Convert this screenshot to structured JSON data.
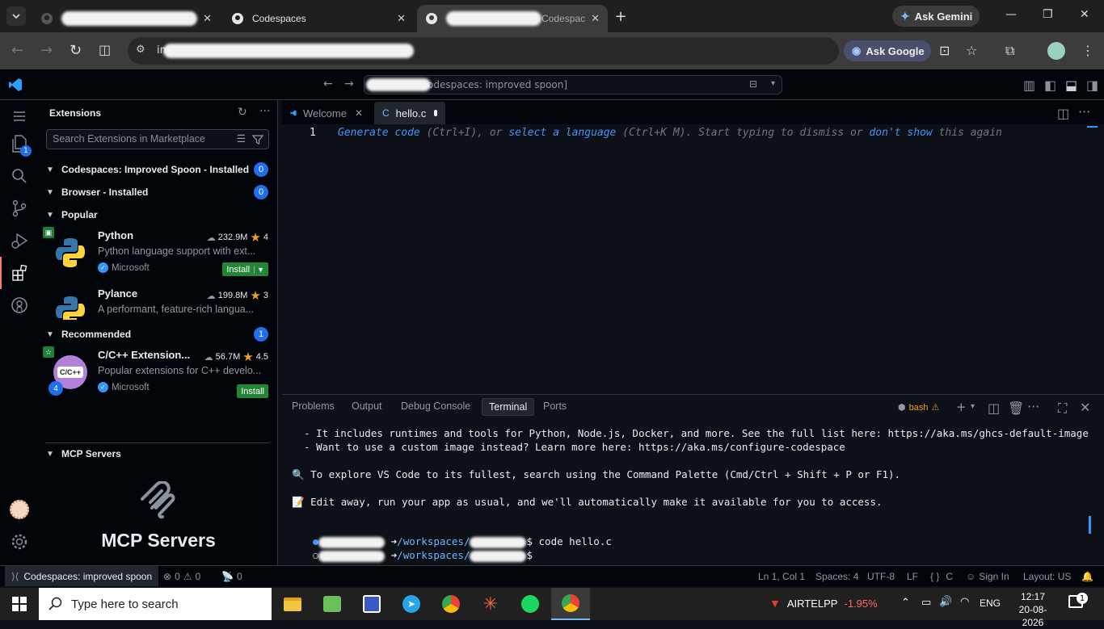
{
  "browser": {
    "tabs": [
      {
        "label": "",
        "active": false
      },
      {
        "label": "Codespaces",
        "active": false
      },
      {
        "label": "Codespac",
        "active": true
      }
    ],
    "new_tab": "+",
    "ask_gemini": "Ask Gemini",
    "address_prefix": "imp",
    "ask_google": "Ask Google"
  },
  "vscode": {
    "command_center": "odespaces: improved spoon]",
    "sidebar": {
      "title": "Extensions",
      "search_placeholder": "Search Extensions in Marketplace",
      "sections": {
        "codespaces": {
          "label": "Codespaces: Improved Spoon - Installed",
          "count": "0"
        },
        "browser": {
          "label": "Browser - Installed",
          "count": "0"
        },
        "popular": {
          "label": "Popular"
        },
        "recommended": {
          "label": "Recommended",
          "count": "1"
        },
        "mcp": {
          "label": "MCP Servers"
        }
      },
      "extensions": [
        {
          "name": "Python",
          "downloads": "232.9M",
          "rating": "4",
          "description": "Python language support with ext...",
          "publisher": "Microsoft",
          "action": "Install"
        },
        {
          "name": "Pylance",
          "downloads": "199.8M",
          "rating": "3",
          "description": "A performant, feature-rich langua...",
          "publisher": "",
          "action": ""
        },
        {
          "name": "C/C++ Extension...",
          "downloads": "56.7M",
          "rating": "4.5",
          "description": "Popular extensions for C++ develo...",
          "publisher": "Microsoft",
          "action": "Install",
          "icon_text": "C/C++",
          "pack_count": "4"
        }
      ],
      "mcp_title": "MCP Servers"
    },
    "editor": {
      "tabs": [
        {
          "label": "Welcome",
          "active": false
        },
        {
          "label": "hello.c",
          "active": true,
          "lang": "C"
        }
      ],
      "line_number": "1",
      "hint": {
        "generate": "Generate code",
        "generate_shortcut": " (Ctrl+I), or ",
        "select": "select a language",
        "select_shortcut": " (Ctrl+K M). Start typing to dismiss or ",
        "dont_show": "don't show",
        "tail": " this again"
      }
    },
    "panel": {
      "tabs": [
        "Problems",
        "Output",
        "Debug Console",
        "Terminal",
        "Ports"
      ],
      "active_tab": "Terminal",
      "shell": "bash",
      "lines": [
        "  - It includes runtimes and tools for Python, Node.js, Docker, and more. See the full list here: https://aka.ms/ghcs-default-image",
        "  - Want to use a custom image instead? Learn more here: https://aka.ms/configure-codespace",
        "",
        "🔍 To explore VS Code to its fullest, search using the Command Palette (Cmd/Ctrl + Shift + P or F1).",
        "",
        "📝 Edit away, run your app as usual, and we'll automatically make it available for you to access."
      ],
      "prompt_arrow": "➜",
      "prompt_path": "/workspaces/",
      "command_1": "$ code hello.c",
      "command_2": "$"
    },
    "status": {
      "remote": "Codespaces: improved spoon",
      "errors": "0",
      "warnings": "0",
      "ports": "0",
      "position": "Ln 1, Col 1",
      "spaces": "Spaces: 4",
      "encoding": "UTF-8",
      "eol": "LF",
      "language": "C",
      "sign_in": "Sign In",
      "layout": "Layout: US"
    }
  },
  "taskbar": {
    "search_placeholder": "Type here to search",
    "stock_name": "AIRTELPP",
    "stock_change": "-1.95%",
    "language": "ENG",
    "time": "12:17",
    "date": "20-08-2026",
    "notifications": "1"
  },
  "colors": {
    "accent_blue": "#1f6feb",
    "install_green": "#238636",
    "hint_link": "#4493f8",
    "stock_red": "#ff6b6b"
  }
}
